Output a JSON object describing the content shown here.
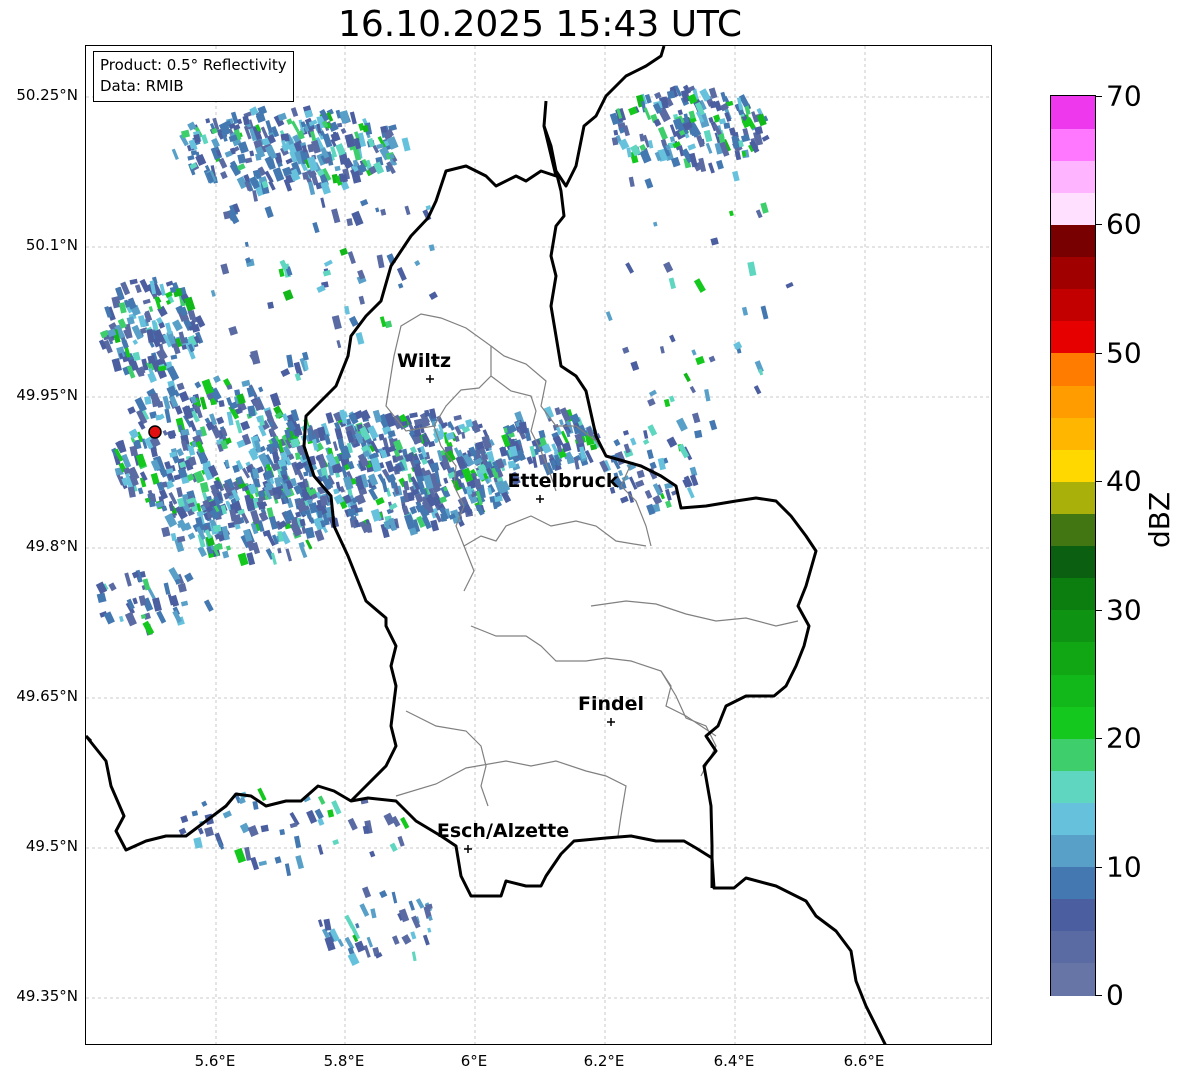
{
  "title": "16.10.2025 15:43 UTC",
  "info_box": {
    "product": "Product: 0.5° Reflectivity",
    "data_source": "Data: RMIB"
  },
  "lat_labels": [
    "50.25°N",
    "50.1°N",
    "49.95°N",
    "49.8°N",
    "49.65°N",
    "49.5°N",
    "49.35°N"
  ],
  "lon_labels": [
    "5.6°E",
    "5.8°E",
    "6°E",
    "6.2°E",
    "6.4°E",
    "6.6°E"
  ],
  "cities": [
    {
      "name": "Wiltz"
    },
    {
      "name": "Ettelbruck"
    },
    {
      "name": "Findel"
    },
    {
      "name": "Esch/Alzette"
    }
  ],
  "colorbar": {
    "unit": "dBZ",
    "ticks": [
      "70",
      "60",
      "50",
      "40",
      "30",
      "20",
      "10",
      "0"
    ],
    "colors": [
      "#6674a6",
      "#5a6aa2",
      "#4a5ea0",
      "#4378b0",
      "#58a0c8",
      "#66c2dc",
      "#5fd6c0",
      "#3ecf6c",
      "#14c81e",
      "#12b81a",
      "#10a614",
      "#0e9412",
      "#0c7e10",
      "#0a6010",
      "#427612",
      "#aab00a",
      "#ffd800",
      "#ffb600",
      "#ff9c00",
      "#ff7c00",
      "#e60000",
      "#c20000",
      "#a00000",
      "#780000",
      "#ffe0ff",
      "#ffb4ff",
      "#ff78ff",
      "#ee38ee"
    ]
  },
  "colors": {
    "border_national": "#000000",
    "border_canton": "#808080",
    "radar_site": "#e01010"
  }
}
